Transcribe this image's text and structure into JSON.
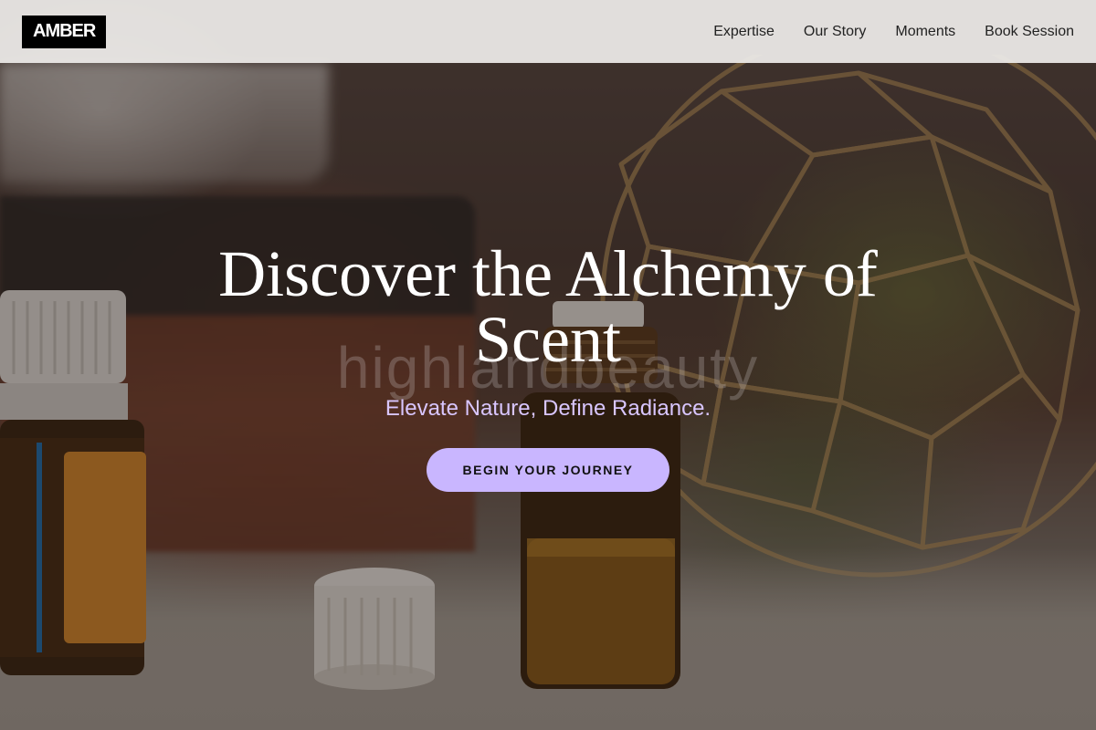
{
  "brand": {
    "logo_text": "AMBER"
  },
  "nav": {
    "links": [
      {
        "label": "Expertise"
      },
      {
        "label": "Our Story"
      },
      {
        "label": "Moments"
      },
      {
        "label": "Book Session"
      }
    ]
  },
  "hero": {
    "title": "Discover the Alchemy of Scent",
    "subtitle": "Elevate Nature, Define Radiance.",
    "cta_label": "BEGIN YOUR JOURNEY",
    "watermark": "highlandbeauty"
  },
  "colors": {
    "accent": "#c9b6ff",
    "subtitle": "#d9c6ff",
    "logo_bg": "#000000",
    "navbar_bg": "#eeece9"
  }
}
